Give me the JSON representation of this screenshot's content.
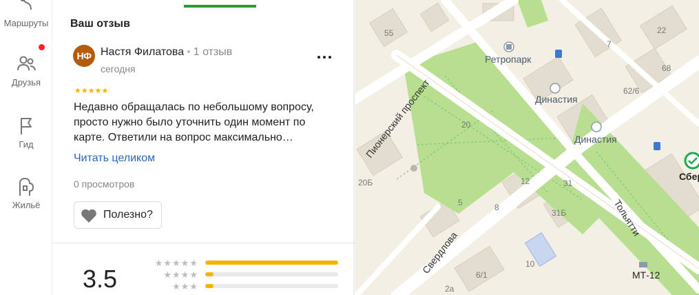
{
  "sidebar": {
    "items": [
      {
        "label": "Маршруты",
        "icon": "route-icon"
      },
      {
        "label": "Друзья",
        "icon": "friends-icon",
        "notification": true
      },
      {
        "label": "Гид",
        "icon": "flag-icon"
      },
      {
        "label": "Жильё",
        "icon": "house-icon"
      }
    ]
  },
  "reviews": {
    "section_title": "Ваш отзыв",
    "review": {
      "avatar_initials": "НФ",
      "author": "Настя Филатова",
      "separator": "•",
      "review_count": "1 отзыв",
      "date": "сегодня",
      "stars": "★★★★★",
      "text": "Недавно обращалась по небольшому вопросу, просто нужно было уточнить один момент по карте. Ответили на вопрос максимально…",
      "read_more": "Читать целиком",
      "views": "0 просмотров",
      "useful_label": "Полезно?"
    },
    "summary": {
      "rating": "3.5",
      "breakdown": [
        {
          "stars": "★★★★★",
          "share": 1.0
        },
        {
          "stars": "★★★★",
          "share": 0.06
        },
        {
          "stars": "★★★",
          "share": 0.06
        }
      ]
    }
  },
  "map": {
    "labels": {
      "b55": "55",
      "b7": "7",
      "b22": "22",
      "b68": "68",
      "b62_6": "62/6",
      "b20": "20",
      "b20b": "20Б",
      "b5": "5",
      "b8": "8",
      "b12": "12",
      "b31": "31",
      "b31b": "31Б",
      "b10": "10",
      "b6_1": "6/1",
      "b2a": "2а"
    },
    "pois": {
      "retropark": "Ретропарк",
      "dinastiya_1": "Династия",
      "dinastiya_2": "Династия",
      "sberbank": "СберБ",
      "mt12": "МТ-12"
    },
    "streets": {
      "pionersky": "Пионерский проспект",
      "sverdlova": "Свердлова",
      "tolyatti": "Тольятти"
    },
    "colors": {
      "background": "#f3efe4",
      "park": "#b7df8f",
      "road": "#ffffff",
      "building": "#e3ddd0",
      "accent": "#2c9b3a",
      "star": "#f5b400",
      "link": "#2a68b8"
    }
  }
}
